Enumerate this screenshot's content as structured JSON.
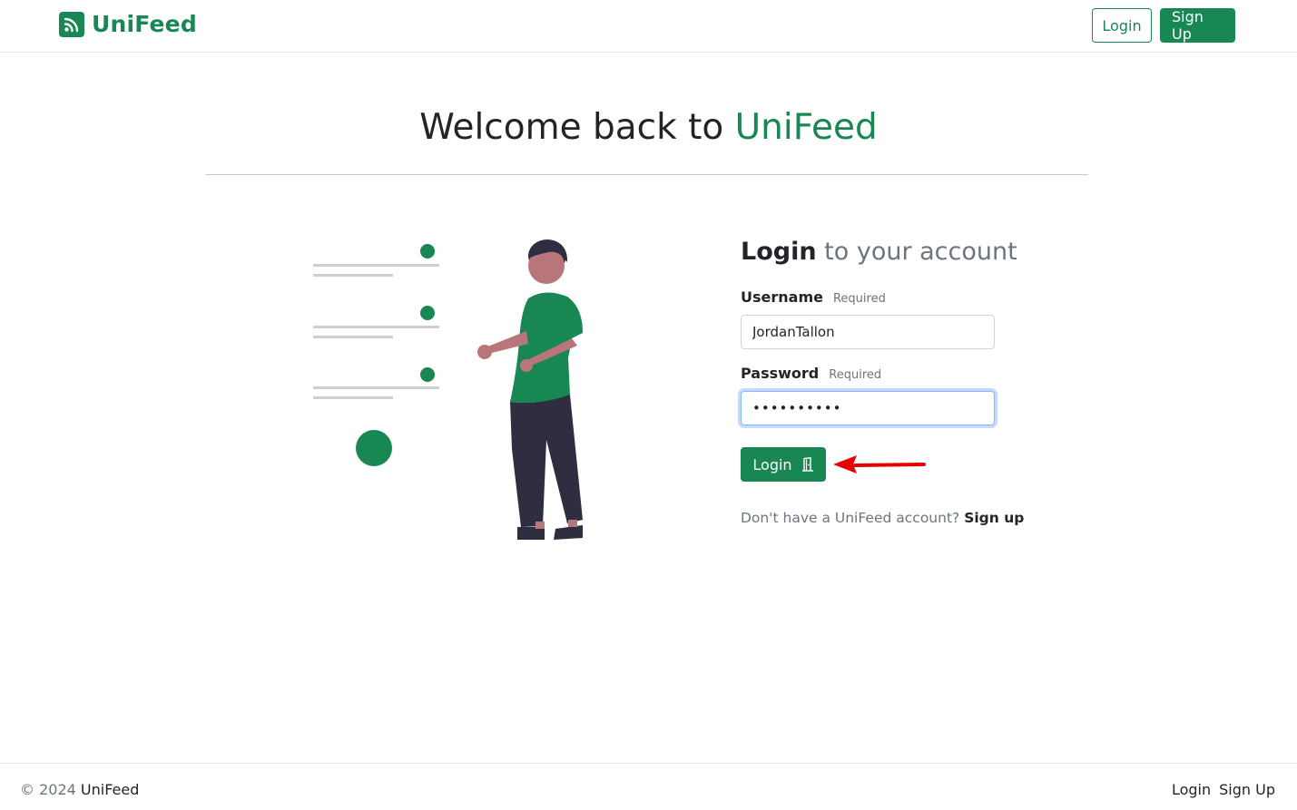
{
  "navbar": {
    "brand": "UniFeed",
    "brand_icon": "rss-feed-icon",
    "login_label": "Login",
    "signup_label": "Sign Up"
  },
  "hero": {
    "title_prefix": "Welcome back to",
    "title_accent": "UniFeed"
  },
  "illustration": {
    "description_icon": "person-checklist-illustration"
  },
  "login_form": {
    "heading_strong": "Login",
    "heading_rest": "to your account",
    "username": {
      "label": "Username",
      "required": "Required",
      "value": "JordanTallon"
    },
    "password": {
      "label": "Password",
      "required": "Required",
      "value": "••••••••••"
    },
    "submit_label": "Login",
    "submit_icon": "door-icon",
    "signup_prompt": "Don't have a UniFeed account?",
    "signup_link": "Sign up"
  },
  "footer": {
    "copyright_prefix": "© 2024",
    "copyright_brand": "UniFeed",
    "links": [
      "Login",
      "Sign Up"
    ]
  },
  "colors": {
    "brand": "#198754",
    "text": "#212529",
    "muted": "#6c757d",
    "annotation_arrow": "#e60000"
  }
}
